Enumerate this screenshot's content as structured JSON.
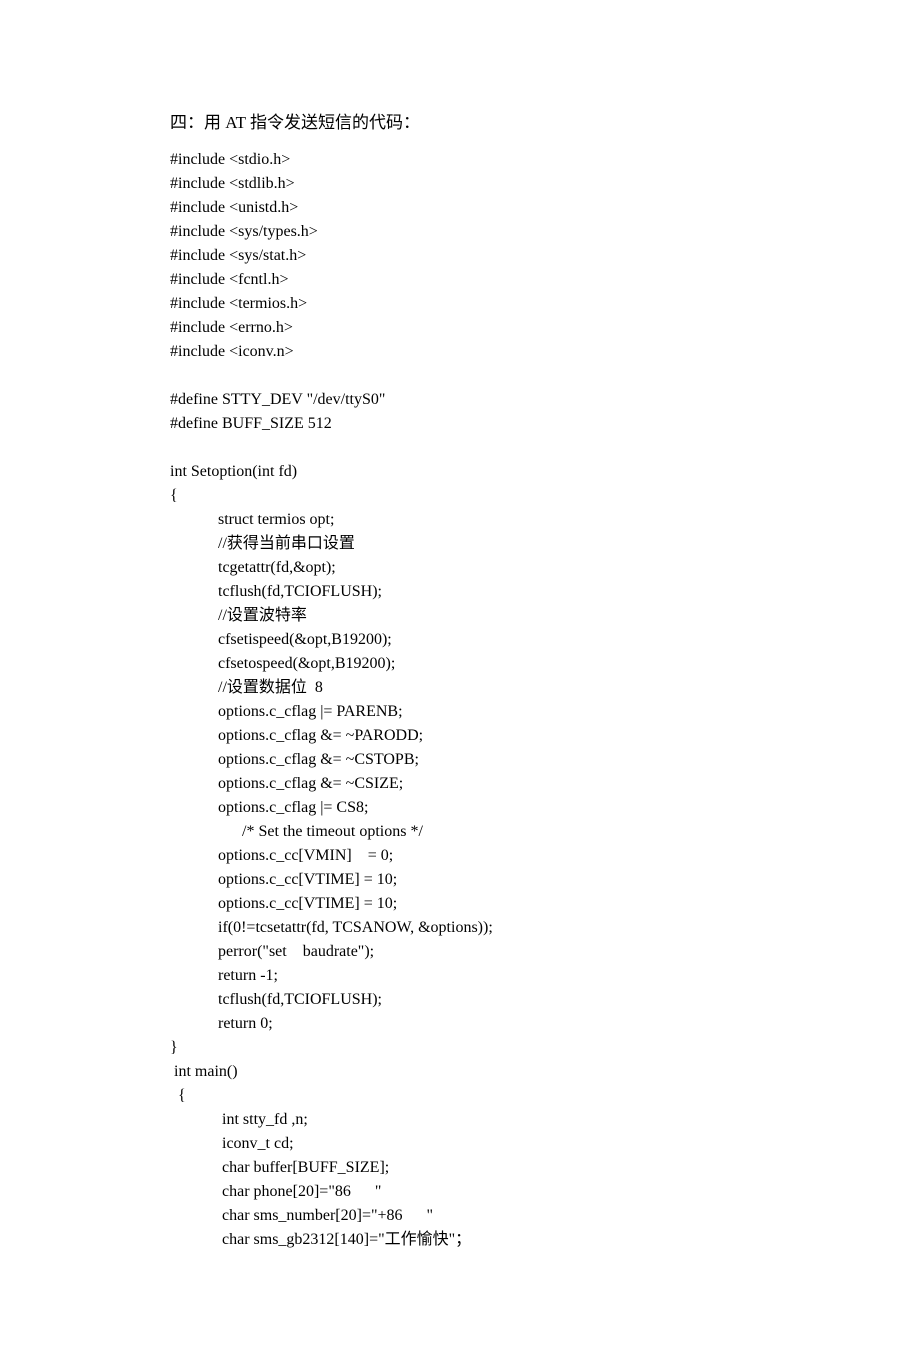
{
  "title": "四：用 AT 指令发送短信的代码：",
  "lines": [
    {
      "text": "#include <stdio.h>",
      "indent": 0
    },
    {
      "text": "#include <stdlib.h>",
      "indent": 0
    },
    {
      "text": "#include <unistd.h>",
      "indent": 0
    },
    {
      "text": "#include <sys/types.h>",
      "indent": 0
    },
    {
      "text": "#include <sys/stat.h>",
      "indent": 0
    },
    {
      "text": "#include <fcntl.h>",
      "indent": 0
    },
    {
      "text": "#include <termios.h>",
      "indent": 0
    },
    {
      "text": "#include <errno.h>",
      "indent": 0
    },
    {
      "text": "#include <iconv.n>",
      "indent": 0
    },
    {
      "text": "",
      "indent": 0,
      "blank": true
    },
    {
      "text": "#define STTY_DEV \"/dev/ttyS0\"",
      "indent": 0
    },
    {
      "text": "#define BUFF_SIZE 512",
      "indent": 0
    },
    {
      "text": "",
      "indent": 0,
      "blank": true
    },
    {
      "text": "int Setoption(int fd)",
      "indent": 0
    },
    {
      "text": "{",
      "indent": 0
    },
    {
      "text": "struct termios opt;",
      "indent": 1
    },
    {
      "text": "//获得当前串口设置",
      "indent": 1
    },
    {
      "text": "tcgetattr(fd,&opt);",
      "indent": 1
    },
    {
      "text": "tcflush(fd,TCIOFLUSH);",
      "indent": 1
    },
    {
      "text": "//设置波特率",
      "indent": 1
    },
    {
      "text": "cfsetispeed(&opt,B19200);",
      "indent": 1
    },
    {
      "text": "cfsetospeed(&opt,B19200);",
      "indent": 1
    },
    {
      "text": "//设置数据位  8",
      "indent": 1
    },
    {
      "text": "options.c_cflag |= PARENB;",
      "indent": 1
    },
    {
      "text": "options.c_cflag &= ~PARODD;",
      "indent": 1
    },
    {
      "text": "options.c_cflag &= ~CSTOPB;",
      "indent": 1
    },
    {
      "text": "options.c_cflag &= ~CSIZE;",
      "indent": 1
    },
    {
      "text": "options.c_cflag |= CS8;",
      "indent": 1
    },
    {
      "text": "/* Set the timeout options */",
      "indent": 2
    },
    {
      "text": "options.c_cc[VMIN]    = 0;",
      "indent": 1
    },
    {
      "text": "options.c_cc[VTIME] = 10;",
      "indent": 1
    },
    {
      "text": "options.c_cc[VTIME] = 10;",
      "indent": 1
    },
    {
      "text": "if(0!=tcsetattr(fd, TCSANOW, &options));",
      "indent": 1
    },
    {
      "text": "perror(\"set    baudrate\");",
      "indent": 1
    },
    {
      "text": "return -1;",
      "indent": 1
    },
    {
      "text": "tcflush(fd,TCIOFLUSH);",
      "indent": 1
    },
    {
      "text": "return 0;",
      "indent": 1
    },
    {
      "text": "}",
      "indent": 0
    },
    {
      "text": " int main()",
      "indent": 0
    },
    {
      "text": "  {",
      "indent": 0
    },
    {
      "text": " int stty_fd ,n;",
      "indent": 1
    },
    {
      "text": " iconv_t cd;",
      "indent": 1
    },
    {
      "text": " char buffer[BUFF_SIZE];",
      "indent": 1
    },
    {
      "text": " char phone[20]=\"86      \"",
      "indent": 1
    },
    {
      "text": " char sms_number[20]=\"+86      \"",
      "indent": 1
    },
    {
      "text": " char sms_gb2312[140]=\"工作愉快\"；",
      "indent": 1
    }
  ]
}
